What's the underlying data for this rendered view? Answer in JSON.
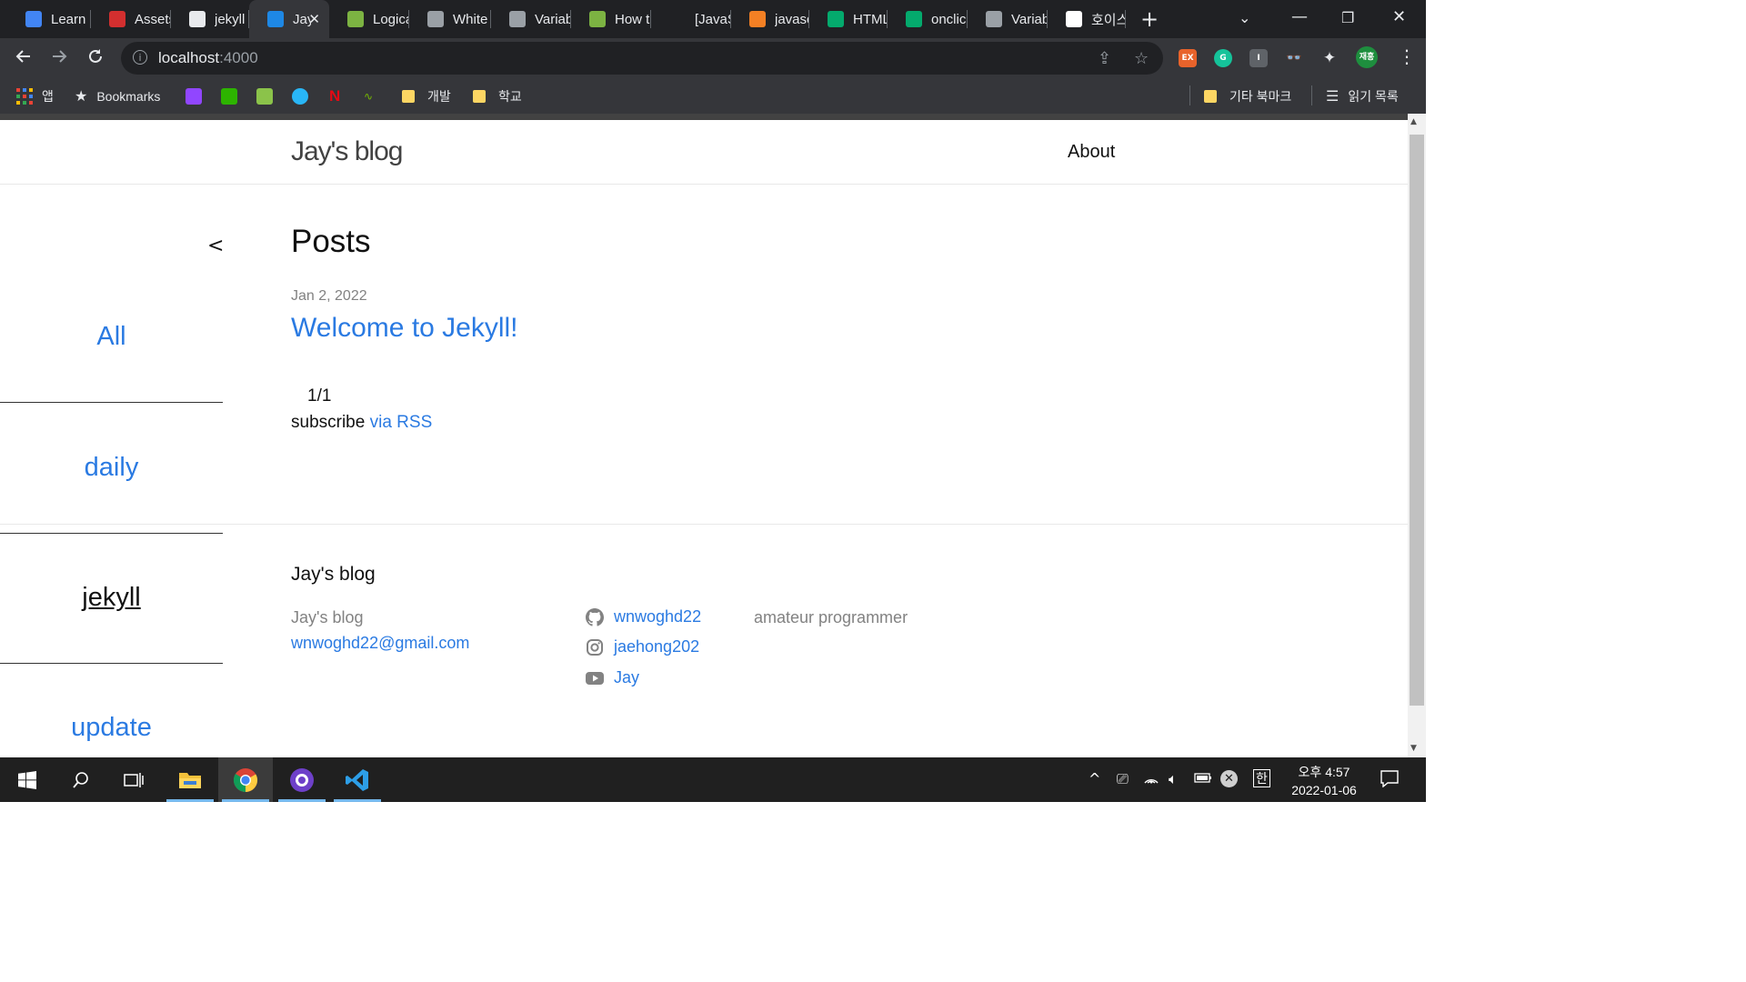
{
  "browser": {
    "tabs": [
      {
        "title": "Learn",
        "favicon_color": "#4285f4",
        "favicon": "user-icon"
      },
      {
        "title": "Assets",
        "favicon_color": "#d32f2f",
        "favicon": "pen-icon"
      },
      {
        "title": "jekyll",
        "favicon_color": "#e8eaed",
        "favicon": "globe-icon"
      },
      {
        "title": "Jay",
        "favicon_color": "#1e88e5",
        "favicon": "letter-j-icon",
        "active": true
      },
      {
        "title": "Logica",
        "favicon_color": "#7cb342",
        "favicon": "shopify-icon"
      },
      {
        "title": "White",
        "favicon_color": "#9aa0a6",
        "favicon": "drop-icon"
      },
      {
        "title": "Variab",
        "favicon_color": "#9aa0a6",
        "favicon": "drop-icon"
      },
      {
        "title": "How t",
        "favicon_color": "#7cb342",
        "favicon": "shopify-icon"
      },
      {
        "title": "[JavaS",
        "favicon_color": "#202124",
        "favicon": "blank-icon"
      },
      {
        "title": "javasc",
        "favicon_color": "#f48024",
        "favicon": "stackoverflow-icon"
      },
      {
        "title": "HTML",
        "favicon_color": "#04aa6d",
        "favicon": "w3schools-icon"
      },
      {
        "title": "onclic",
        "favicon_color": "#04aa6d",
        "favicon": "w3schools-icon"
      },
      {
        "title": "Variab",
        "favicon_color": "#9aa0a6",
        "favicon": "drop-icon"
      },
      {
        "title": "호이스",
        "favicon_color": "#ffffff",
        "favicon": "google-icon"
      }
    ],
    "url_host": "localhost",
    "url_port": ":4000",
    "profile_label": "재홍",
    "ext_ex_label": "EX",
    "ext_i_label": "I",
    "bookmarks": {
      "apps_label": "앱",
      "bookmarks_label": "Bookmarks",
      "folder_dev": "개발",
      "folder_school": "학교",
      "other_bookmarks": "기타 북마크",
      "reading_list": "읽기 목록"
    }
  },
  "site": {
    "title": "Jay's blog",
    "nav_about": "About",
    "sidebar_toggle": "<",
    "categories": [
      "All",
      "daily",
      "jekyll",
      "update"
    ],
    "current_category": "jekyll",
    "posts_heading": "Posts",
    "post": {
      "date": "Jan 2, 2022",
      "title": "Welcome to Jekyll!"
    },
    "pager": "1/1",
    "subscribe_label": "subscribe",
    "subscribe_link": "via RSS",
    "footer": {
      "heading": "Jay's blog",
      "name": "Jay's blog",
      "email": "wnwoghd22@gmail.com",
      "github": "wnwoghd22",
      "instagram": "jaehong202",
      "youtube": "Jay",
      "description": "amateur programmer"
    }
  },
  "taskbar": {
    "clock_time": "오후 4:57",
    "clock_date": "2022-01-06",
    "ime_label": "한"
  }
}
